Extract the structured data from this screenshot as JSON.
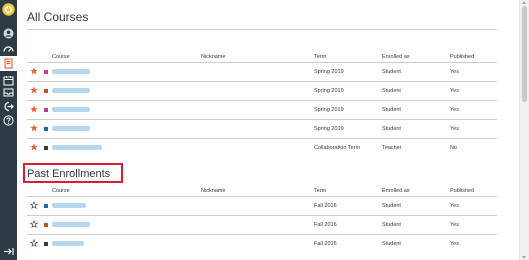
{
  "colors": {
    "nav_bg": "#2d3b45",
    "star_active": "#e66135",
    "star_inactive": "#2d3b45",
    "highlight_border": "#d81e34",
    "link_blurred": "#b9d6ef"
  },
  "nav": {
    "items": [
      {
        "name": "logo",
        "icon": "institution-logo"
      },
      {
        "name": "account",
        "icon": "account-icon"
      },
      {
        "name": "dashboard",
        "icon": "dashboard-icon"
      },
      {
        "name": "courses",
        "icon": "courses-icon",
        "active": true
      },
      {
        "name": "calendar",
        "icon": "calendar-icon"
      },
      {
        "name": "inbox",
        "icon": "inbox-icon"
      },
      {
        "name": "commons",
        "icon": "commons-icon"
      },
      {
        "name": "help",
        "icon": "help-icon"
      },
      {
        "name": "collapse",
        "icon": "collapse-icon"
      }
    ]
  },
  "page": {
    "title": "All Courses"
  },
  "current": {
    "headers": {
      "course": "Course",
      "nickname": "Nickname",
      "term": "Term",
      "enrolled": "Enrolled as",
      "published": "Published"
    },
    "rows": [
      {
        "starred": true,
        "color": "#bd3c97",
        "term": "Spring 2019",
        "enrolled": "Student",
        "published": "Yes"
      },
      {
        "starred": true,
        "color": "#c2541b",
        "term": "Spring 2019",
        "enrolled": "Student",
        "published": "Yes"
      },
      {
        "starred": true,
        "color": "#bd3c97",
        "term": "Spring 2019",
        "enrolled": "Student",
        "published": "Yes"
      },
      {
        "starred": true,
        "color": "#1e6a9e",
        "term": "Spring 2019",
        "enrolled": "Student",
        "published": "Yes"
      },
      {
        "starred": true,
        "color": "#2d3b45",
        "term": "Collaboration Term",
        "enrolled": "Teacher",
        "published": "No"
      }
    ]
  },
  "past": {
    "title": "Past Enrollments",
    "headers": {
      "course": "Course",
      "nickname": "Nickname",
      "term": "Term",
      "enrolled": "Enrolled as",
      "published": "Published"
    },
    "rows": [
      {
        "starred": false,
        "color": "#1e6a9e",
        "term": "Fall 2016",
        "enrolled": "Student",
        "published": "Yes"
      },
      {
        "starred": false,
        "color": "#c2541b",
        "term": "Fall 2016",
        "enrolled": "Student",
        "published": "Yes"
      },
      {
        "starred": false,
        "color": "#2d3b45",
        "term": "Fall 2016",
        "enrolled": "Student",
        "published": "Yes"
      }
    ]
  }
}
